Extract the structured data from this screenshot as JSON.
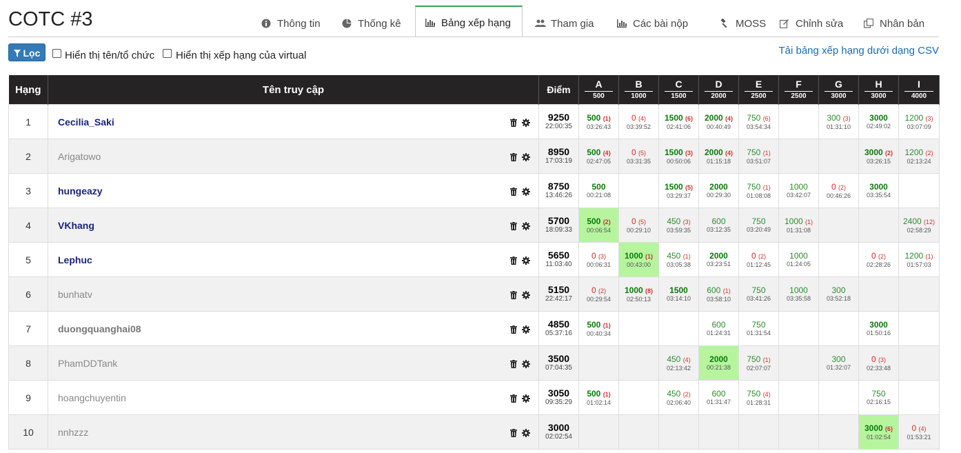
{
  "page": {
    "title": "COTC #3"
  },
  "tabs": [
    {
      "label": "Thông tin",
      "icon": "info-icon",
      "active": false
    },
    {
      "label": "Thống kê",
      "icon": "pie-chart-icon",
      "active": false
    },
    {
      "label": "Bảng xếp hạng",
      "icon": "bar-chart-icon",
      "active": true
    },
    {
      "label": "Tham gia",
      "icon": "users-icon",
      "active": false
    },
    {
      "label": "Các bài nộp",
      "icon": "bar-chart-icon",
      "active": false
    },
    {
      "label": "MOSS",
      "icon": "gavel-icon",
      "active": false
    },
    {
      "label": "Chỉnh sửa",
      "icon": "edit-icon",
      "active": false
    },
    {
      "label": "Nhân bản",
      "icon": "clone-icon",
      "active": false
    }
  ],
  "filter": {
    "button_label": "Lọc",
    "show_name_label": "Hiển thị tên/tổ chức",
    "show_virtual_label": "Hiển thị xếp hạng của virtual",
    "csv_link": "Tải bảng xếp hạng dưới dạng CSV"
  },
  "table": {
    "headers": {
      "rank": "Hạng",
      "user": "Tên truy cập",
      "score": "Điểm"
    },
    "problems": [
      {
        "letter": "A",
        "points": "500"
      },
      {
        "letter": "B",
        "points": "1000"
      },
      {
        "letter": "C",
        "points": "1500"
      },
      {
        "letter": "D",
        "points": "2000"
      },
      {
        "letter": "E",
        "points": "2500"
      },
      {
        "letter": "F",
        "points": "2500"
      },
      {
        "letter": "G",
        "points": "3000"
      },
      {
        "letter": "H",
        "points": "3000"
      },
      {
        "letter": "I",
        "points": "4000"
      }
    ],
    "rows": [
      {
        "rank": "1",
        "user": "Cecilia_Saki",
        "style": "blue",
        "score": "9250",
        "time": "22:00:35",
        "cells": [
          {
            "v": "500",
            "a": "(1)",
            "t": "03:26:43",
            "k": "full"
          },
          {
            "v": "0",
            "a": "(4)",
            "t": "03:39:52",
            "k": "zero"
          },
          {
            "v": "1500",
            "a": "(6)",
            "t": "02:41:06",
            "k": "full"
          },
          {
            "v": "2000",
            "a": "(4)",
            "t": "00:40:49",
            "k": "full"
          },
          {
            "v": "750",
            "a": "(6)",
            "t": "03:54:34",
            "k": "partial"
          },
          null,
          {
            "v": "300",
            "a": "(3)",
            "t": "01:31:10",
            "k": "partial"
          },
          {
            "v": "3000",
            "a": "",
            "t": "02:49:02",
            "k": "full"
          },
          {
            "v": "1200",
            "a": "(3)",
            "t": "03:07:09",
            "k": "partial"
          }
        ]
      },
      {
        "rank": "2",
        "user": "Arigatowo",
        "style": "grey",
        "score": "8950",
        "time": "17:03:19",
        "cells": [
          {
            "v": "500",
            "a": "(4)",
            "t": "02:47:05",
            "k": "full"
          },
          {
            "v": "0",
            "a": "(5)",
            "t": "03:31:35",
            "k": "zero"
          },
          {
            "v": "1500",
            "a": "(3)",
            "t": "00:50:06",
            "k": "full"
          },
          {
            "v": "2000",
            "a": "(4)",
            "t": "01:15:18",
            "k": "full"
          },
          {
            "v": "750",
            "a": "(1)",
            "t": "03:51:07",
            "k": "partial"
          },
          null,
          null,
          {
            "v": "3000",
            "a": "(2)",
            "t": "03:26:15",
            "k": "full"
          },
          {
            "v": "1200",
            "a": "(2)",
            "t": "02:13:24",
            "k": "partial"
          }
        ]
      },
      {
        "rank": "3",
        "user": "hungeazy",
        "style": "blue",
        "score": "8750",
        "time": "13:46:26",
        "cells": [
          {
            "v": "500",
            "a": "",
            "t": "00:21:08",
            "k": "full"
          },
          null,
          {
            "v": "1500",
            "a": "(5)",
            "t": "03:29:37",
            "k": "full"
          },
          {
            "v": "2000",
            "a": "",
            "t": "00:29:30",
            "k": "full"
          },
          {
            "v": "750",
            "a": "(1)",
            "t": "01:08:08",
            "k": "partial"
          },
          {
            "v": "1000",
            "a": "",
            "t": "03:42:07",
            "k": "partial"
          },
          {
            "v": "0",
            "a": "(2)",
            "t": "00:46:26",
            "k": "zero"
          },
          {
            "v": "3000",
            "a": "",
            "t": "03:35:54",
            "k": "full"
          },
          null
        ]
      },
      {
        "rank": "4",
        "user": "VKhang",
        "style": "blue",
        "score": "5700",
        "time": "18:09:33",
        "cells": [
          {
            "v": "500",
            "a": "(2)",
            "t": "00:06:54",
            "k": "first"
          },
          {
            "v": "0",
            "a": "(5)",
            "t": "00:29:10",
            "k": "zero"
          },
          {
            "v": "450",
            "a": "(3)",
            "t": "03:59:35",
            "k": "partial"
          },
          {
            "v": "600",
            "a": "",
            "t": "03:12:35",
            "k": "partial"
          },
          {
            "v": "750",
            "a": "",
            "t": "03:20:49",
            "k": "partial"
          },
          {
            "v": "1000",
            "a": "(1)",
            "t": "01:31:08",
            "k": "partial"
          },
          null,
          null,
          {
            "v": "2400",
            "a": "(12)",
            "t": "02:58:29",
            "k": "partial"
          }
        ]
      },
      {
        "rank": "5",
        "user": "Lephuc",
        "style": "blue",
        "score": "5650",
        "time": "11:03:40",
        "cells": [
          {
            "v": "0",
            "a": "(3)",
            "t": "00:06:31",
            "k": "zero"
          },
          {
            "v": "1000",
            "a": "(1)",
            "t": "00:43:00",
            "k": "first"
          },
          {
            "v": "450",
            "a": "(1)",
            "t": "03:05:38",
            "k": "partial"
          },
          {
            "v": "2000",
            "a": "",
            "t": "03:23:51",
            "k": "full"
          },
          {
            "v": "0",
            "a": "(2)",
            "t": "01:12:45",
            "k": "zero"
          },
          {
            "v": "1000",
            "a": "",
            "t": "01:24:05",
            "k": "partial"
          },
          null,
          {
            "v": "0",
            "a": "(2)",
            "t": "02:28:26",
            "k": "zero"
          },
          {
            "v": "1200",
            "a": "(1)",
            "t": "01:57:03",
            "k": "partial"
          }
        ]
      },
      {
        "rank": "6",
        "user": "bunhatv",
        "style": "grey",
        "score": "5150",
        "time": "22:42:17",
        "cells": [
          {
            "v": "0",
            "a": "(2)",
            "t": "00:29:54",
            "k": "zero"
          },
          {
            "v": "1000",
            "a": "(8)",
            "t": "02:50:13",
            "k": "full"
          },
          {
            "v": "1500",
            "a": "",
            "t": "03:14:10",
            "k": "full"
          },
          {
            "v": "600",
            "a": "(1)",
            "t": "03:58:10",
            "k": "partial"
          },
          {
            "v": "750",
            "a": "",
            "t": "03:41:26",
            "k": "partial"
          },
          {
            "v": "1000",
            "a": "",
            "t": "03:35:58",
            "k": "partial"
          },
          {
            "v": "300",
            "a": "",
            "t": "03:52:18",
            "k": "partial"
          },
          null,
          null
        ]
      },
      {
        "rank": "7",
        "user": "duongquanghai08",
        "style": "greybold",
        "score": "4850",
        "time": "05:37:16",
        "cells": [
          {
            "v": "500",
            "a": "(1)",
            "t": "00:40:34",
            "k": "full"
          },
          null,
          null,
          {
            "v": "600",
            "a": "",
            "t": "01:24:31",
            "k": "partial"
          },
          {
            "v": "750",
            "a": "",
            "t": "01:31:54",
            "k": "partial"
          },
          null,
          null,
          {
            "v": "3000",
            "a": "",
            "t": "01:50:16",
            "k": "full"
          },
          null
        ]
      },
      {
        "rank": "8",
        "user": "PhamDDTank",
        "style": "grey",
        "score": "3500",
        "time": "07:04:35",
        "cells": [
          null,
          null,
          {
            "v": "450",
            "a": "(4)",
            "t": "02:13:42",
            "k": "partial"
          },
          {
            "v": "2000",
            "a": "",
            "t": "00:21:38",
            "k": "first"
          },
          {
            "v": "750",
            "a": "(1)",
            "t": "02:07:07",
            "k": "partial"
          },
          null,
          {
            "v": "300",
            "a": "",
            "t": "01:32:07",
            "k": "partial"
          },
          {
            "v": "0",
            "a": "(3)",
            "t": "02:33:48",
            "k": "zero"
          },
          null
        ]
      },
      {
        "rank": "9",
        "user": "hoangchuyentin",
        "style": "grey",
        "score": "3050",
        "time": "09:35:29",
        "cells": [
          {
            "v": "500",
            "a": "(1)",
            "t": "01:02:14",
            "k": "full"
          },
          null,
          {
            "v": "450",
            "a": "(2)",
            "t": "02:06:40",
            "k": "partial"
          },
          {
            "v": "600",
            "a": "",
            "t": "01:31:47",
            "k": "partial"
          },
          {
            "v": "750",
            "a": "(4)",
            "t": "01:28:31",
            "k": "partial"
          },
          null,
          null,
          {
            "v": "750",
            "a": "",
            "t": "02:16:15",
            "k": "partial"
          },
          null
        ]
      },
      {
        "rank": "10",
        "user": "nnhzzz",
        "style": "grey",
        "score": "3000",
        "time": "02:02:54",
        "cells": [
          null,
          null,
          null,
          null,
          null,
          null,
          null,
          {
            "v": "3000",
            "a": "(6)",
            "t": "01:02:54",
            "k": "first"
          },
          {
            "v": "0",
            "a": "(4)",
            "t": "01:53:21",
            "k": "zero"
          }
        ]
      }
    ]
  },
  "colors": {
    "header_bg": "#262324",
    "accent_tab": "#2fa84f",
    "first_solve": "#b6f59e",
    "full": "#0a7a0a",
    "wrong": "#d32f2f",
    "link": "#1a6aad",
    "user_blue": "#1a237e"
  }
}
